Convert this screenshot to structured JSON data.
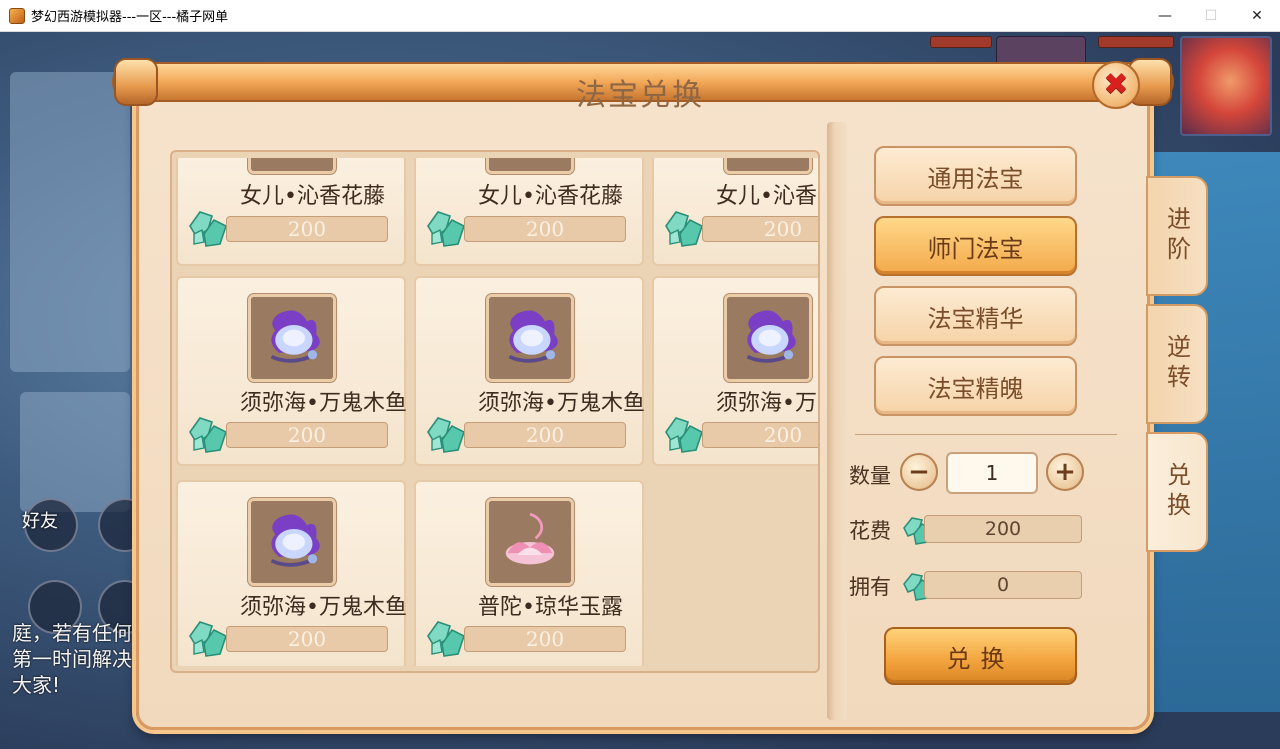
{
  "window": {
    "title": "梦幻西游模拟器---一区---橘子网单",
    "minimize": "—",
    "maximize": "☐",
    "close": "✕"
  },
  "background": {
    "friends_label": "好友",
    "chat_text": "庭，若有任何第一时间解决大家!"
  },
  "dialog": {
    "title": "法宝兑换",
    "close_icon": "✖"
  },
  "items": [
    {
      "name": "女儿•沁香花藤",
      "price": "200",
      "icon": "purple-flower-icon"
    },
    {
      "name": "女儿•沁香花藤",
      "price": "200",
      "icon": "purple-flower-icon"
    },
    {
      "name": "女儿•沁香",
      "price": "200",
      "icon": "purple-flower-icon"
    },
    {
      "name": "须弥海•万鬼木鱼",
      "price": "200",
      "icon": "ghost-wooden-fish-icon"
    },
    {
      "name": "须弥海•万鬼木鱼",
      "price": "200",
      "icon": "ghost-wooden-fish-icon"
    },
    {
      "name": "须弥海•万",
      "price": "200",
      "icon": "ghost-wooden-fish-icon"
    },
    {
      "name": "须弥海•万鬼木鱼",
      "price": "200",
      "icon": "ghost-wooden-fish-icon"
    },
    {
      "name": "普陀•琼华玉露",
      "price": "200",
      "icon": "lotus-icon"
    }
  ],
  "categories": [
    {
      "label": "通用法宝",
      "active": false
    },
    {
      "label": "师门法宝",
      "active": true
    },
    {
      "label": "法宝精华",
      "active": false
    },
    {
      "label": "法宝精魄",
      "active": false
    }
  ],
  "quantity": {
    "label": "数量",
    "value": "1",
    "minus": "−",
    "plus": "+"
  },
  "cost": {
    "label": "花费",
    "value": "200"
  },
  "owned": {
    "label": "拥有",
    "value": "0"
  },
  "exchange_label": "兑换",
  "side_tabs": [
    {
      "label": "进阶",
      "active": false
    },
    {
      "label": "逆转",
      "active": false
    },
    {
      "label": "兑换",
      "active": true
    }
  ],
  "colors": {
    "accent": "#f3a94a",
    "frame": "#d99a63",
    "close_red": "#d8201c"
  }
}
